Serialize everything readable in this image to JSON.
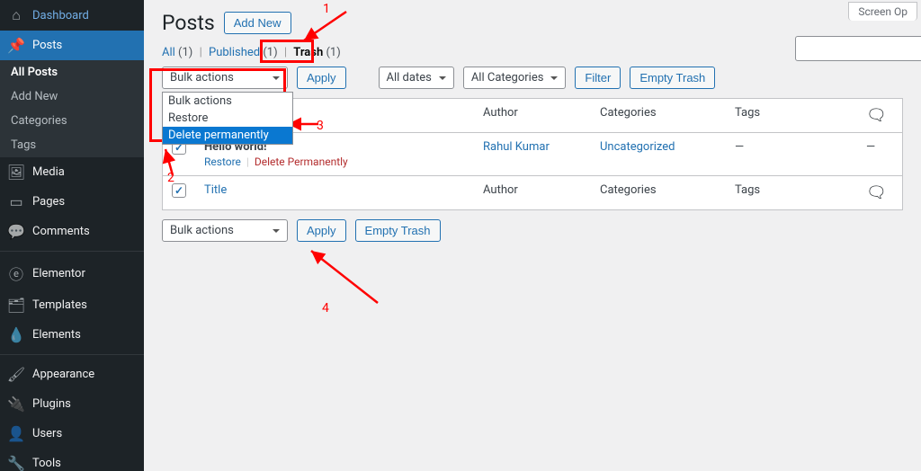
{
  "sidebar": {
    "items": [
      {
        "label": "Dashboard",
        "icon": "⌂"
      },
      {
        "label": "Posts",
        "icon": "📌",
        "active": true,
        "sub": [
          {
            "label": "All Posts",
            "current": true
          },
          {
            "label": "Add New"
          },
          {
            "label": "Categories"
          },
          {
            "label": "Tags"
          }
        ]
      },
      {
        "label": "Media",
        "icon": "🖼"
      },
      {
        "label": "Pages",
        "icon": "▭"
      },
      {
        "label": "Comments",
        "icon": "💬"
      },
      {
        "label": "Elementor",
        "icon": "ⓔ"
      },
      {
        "label": "Templates",
        "icon": "🗂"
      },
      {
        "label": "Elements",
        "icon": "💧"
      },
      {
        "label": "Appearance",
        "icon": "🖌"
      },
      {
        "label": "Plugins",
        "icon": "🔌"
      },
      {
        "label": "Users",
        "icon": "👤"
      },
      {
        "label": "Tools",
        "icon": "🔧"
      }
    ]
  },
  "screen_options": "Screen Op",
  "page": {
    "title": "Posts",
    "add_new": "Add New"
  },
  "views": {
    "all": {
      "label": "All",
      "count": "(1)"
    },
    "published": {
      "label": "Published",
      "count": "(1)"
    },
    "trash": {
      "label": "Trash",
      "count": "(1)"
    }
  },
  "bulk": {
    "selected": "Bulk actions",
    "options": [
      "Bulk actions",
      "Restore",
      "Delete permanently"
    ],
    "apply": "Apply"
  },
  "filters": {
    "dates": "All dates",
    "categories": "All Categories",
    "filter_btn": "Filter",
    "empty_trash": "Empty Trash"
  },
  "table": {
    "cols": {
      "title": "Title",
      "author": "Author",
      "categories": "Categories",
      "tags": "Tags"
    },
    "row": {
      "title": "Hello world!",
      "author": "Rahul Kumar",
      "category": "Uncategorized",
      "tags": "—",
      "comments": "—",
      "actions": {
        "restore": "Restore",
        "delete": "Delete Permanently"
      }
    }
  },
  "bottom": {
    "bulk": "Bulk actions",
    "apply": "Apply",
    "empty_trash": "Empty Trash"
  },
  "annotations": {
    "n1": "1",
    "n2": "2",
    "n3": "3",
    "n4": "4"
  }
}
